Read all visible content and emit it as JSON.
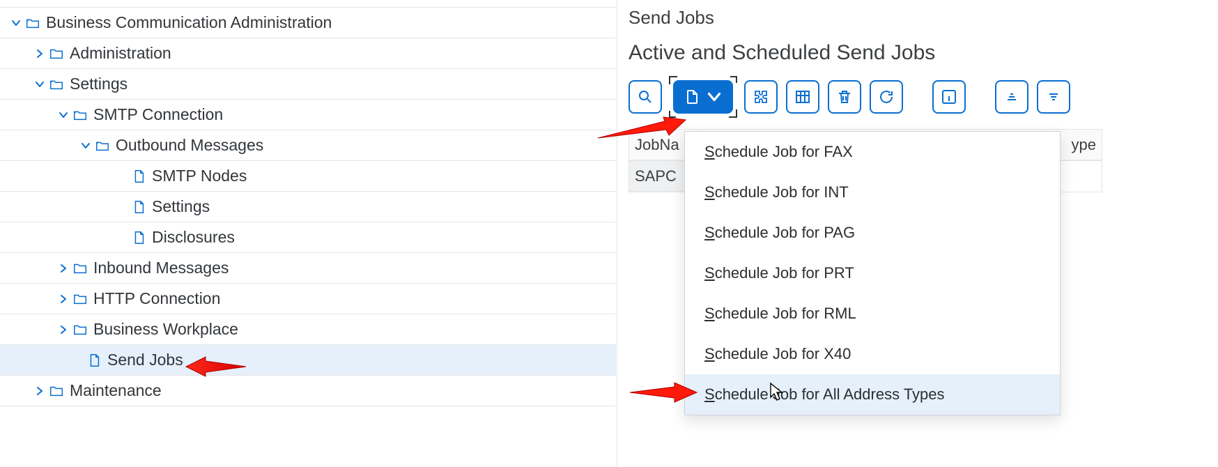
{
  "tree": {
    "root": "Business Communication Administration",
    "items": [
      {
        "label": "Administration",
        "indent": 46,
        "arrow": "right",
        "icon": "folder"
      },
      {
        "label": "Settings",
        "indent": 46,
        "arrow": "down",
        "icon": "folder-open"
      },
      {
        "label": "SMTP Connection",
        "indent": 80,
        "arrow": "down",
        "icon": "folder-open"
      },
      {
        "label": "Outbound Messages",
        "indent": 112,
        "arrow": "down",
        "icon": "folder-open"
      },
      {
        "label": "SMTP Nodes",
        "indent": 164,
        "arrow": "none",
        "icon": "doc"
      },
      {
        "label": "Settings",
        "indent": 164,
        "arrow": "none",
        "icon": "doc"
      },
      {
        "label": "Disclosures",
        "indent": 164,
        "arrow": "none",
        "icon": "doc"
      },
      {
        "label": "Inbound Messages",
        "indent": 80,
        "arrow": "right",
        "icon": "folder"
      },
      {
        "label": "HTTP Connection",
        "indent": 80,
        "arrow": "right",
        "icon": "folder"
      },
      {
        "label": "Business Workplace",
        "indent": 80,
        "arrow": "right",
        "icon": "folder"
      },
      {
        "label": "Send Jobs",
        "indent": 100,
        "arrow": "none",
        "icon": "doc",
        "selected": true
      },
      {
        "label": "Maintenance",
        "indent": 46,
        "arrow": "right",
        "icon": "folder"
      }
    ]
  },
  "right": {
    "page_title": "Send Jobs",
    "section_title": "Active and Scheduled Send Jobs",
    "table": {
      "header": "JobNa",
      "right_header": "ype",
      "cell": "SAPC"
    },
    "dropdown": {
      "prefix": "Schedule Job for ",
      "items": [
        "FAX",
        "INT",
        "PAG",
        "PRT",
        "RML",
        "X40",
        "All Address Types"
      ]
    }
  }
}
